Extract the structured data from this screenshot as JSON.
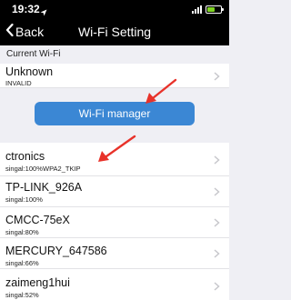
{
  "status_bar": {
    "time": "19:32",
    "location_icon": "location-arrow-icon",
    "signal_icon": "cellular-signal-icon",
    "battery_icon": "battery-charging-icon",
    "battery_level": 0.55,
    "battery_color": "#7ed321"
  },
  "nav": {
    "back_label": "Back",
    "back_icon": "chevron-left-icon",
    "title": "Wi-Fi Setting"
  },
  "current_wifi": {
    "header": "Current Wi-Fi",
    "name": "Unknown",
    "status": "INVALID"
  },
  "manager_button": {
    "label": "Wi-Fi manager",
    "color": "#3b87d4"
  },
  "networks": [
    {
      "name": "ctronics",
      "signal": "singal:100%",
      "security": "WPA2_TKIP"
    },
    {
      "name": "TP-LINK_926A",
      "signal": "singal:100%"
    },
    {
      "name": "CMCC-75eX",
      "signal": "singal:80%"
    },
    {
      "name": "MERCURY_647586",
      "signal": "singal:66%"
    },
    {
      "name": "zaimeng1hui",
      "signal": "singal:52%"
    }
  ],
  "annotation_color": "#e8322a"
}
